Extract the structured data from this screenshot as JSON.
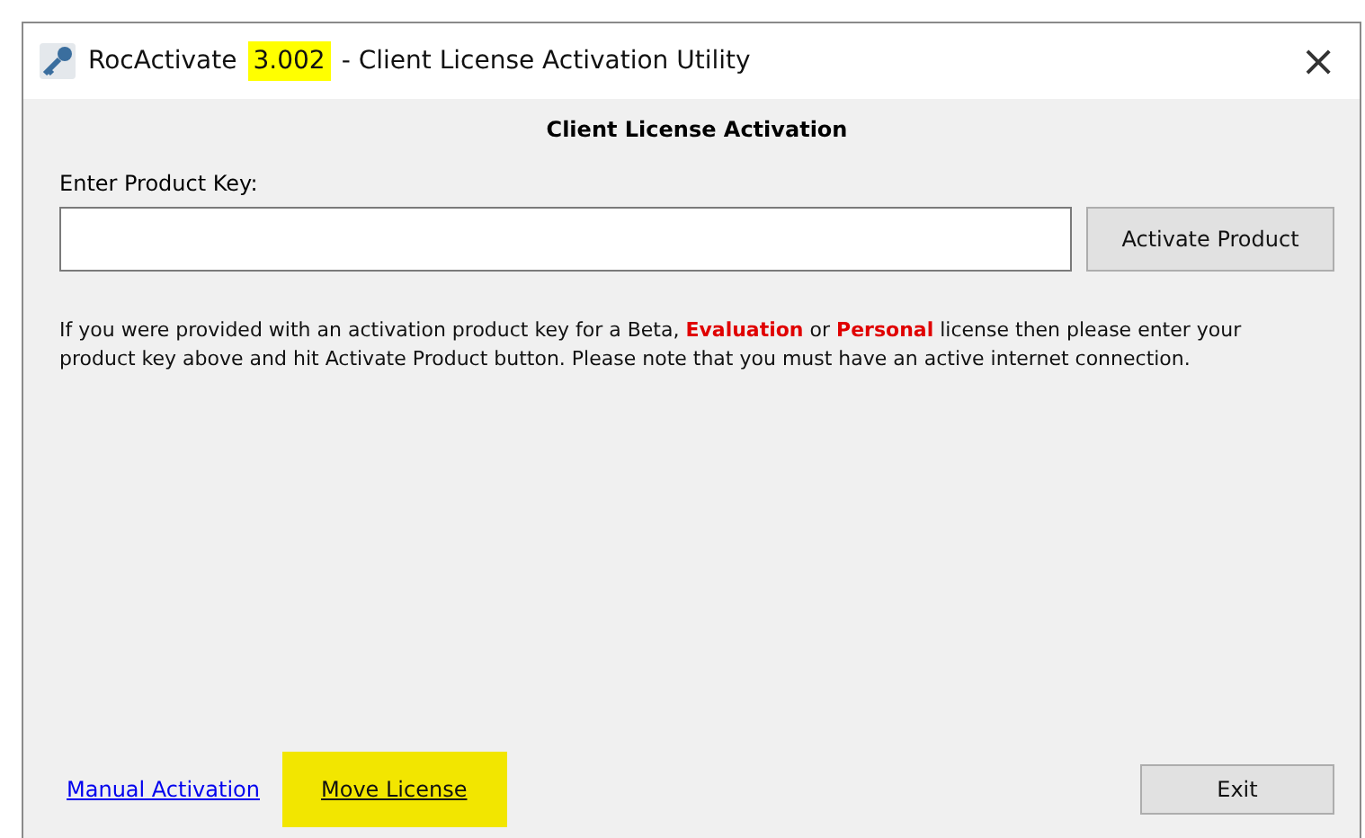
{
  "window": {
    "title_parts": [
      {
        "text": "RocActivate",
        "highlighted": false
      },
      {
        "text": "3.002",
        "highlighted": true
      },
      {
        "text": "- Client License Activation Utility",
        "highlighted": false
      }
    ],
    "close": "×"
  },
  "heading": "Client License Activation",
  "product_key": {
    "label": "Enter Product Key:"
  },
  "activate_button": "Activate Product",
  "notice": [
    {
      "text": "If you were provided with an activation product key for a Beta, ",
      "emphasis": false
    },
    {
      "text": "Evaluation",
      "emphasis": true
    },
    {
      "text": " or ",
      "emphasis": false
    },
    {
      "text": "Personal",
      "emphasis": true
    },
    {
      "text": " license then please enter your product key above and hit Activate Product button. Please note that you must have an active internet connection.",
      "emphasis": false
    }
  ],
  "links": [
    {
      "label": "Manual Activation",
      "highlighted": false
    },
    {
      "label": "Move License",
      "highlighted": true
    }
  ],
  "exit_button": "Exit"
}
